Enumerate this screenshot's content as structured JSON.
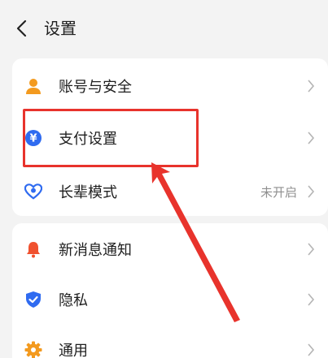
{
  "header": {
    "title": "设置"
  },
  "sections": [
    {
      "items": [
        {
          "label": "账号与安全",
          "icon": "person-icon"
        },
        {
          "label": "支付设置",
          "icon": "yuan-payment-icon"
        },
        {
          "label": "长辈模式",
          "icon": "elder-heart-icon",
          "value": "未开启"
        }
      ]
    },
    {
      "items": [
        {
          "label": "新消息通知",
          "icon": "bell-icon"
        },
        {
          "label": "隐私",
          "icon": "shield-icon"
        },
        {
          "label": "通用",
          "icon": "gear-icon"
        }
      ]
    }
  ],
  "colors": {
    "accent_blue": "#2f6bf0",
    "orange": "#f39a1f",
    "annotation_red": "#e8332c"
  }
}
